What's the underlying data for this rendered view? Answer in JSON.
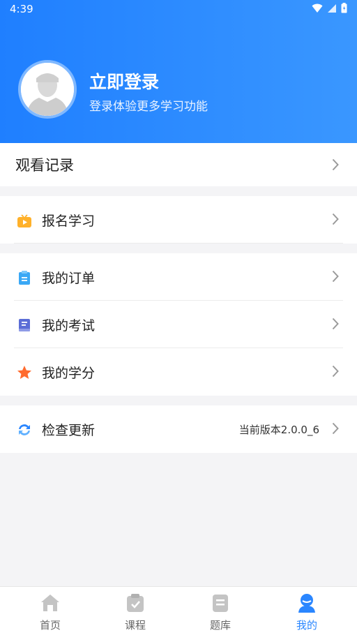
{
  "status_bar": {
    "time": "4:39"
  },
  "profile": {
    "title": "立即登录",
    "subtitle": "登录体验更多学习功能"
  },
  "watch_history": {
    "label": "观看记录"
  },
  "menu": {
    "signup": {
      "label": "报名学习",
      "icon": "tv-play-icon",
      "color": "#ffb12a"
    },
    "orders": {
      "label": "我的订单",
      "icon": "clipboard-icon",
      "color": "#3aa8f5"
    },
    "exams": {
      "label": "我的考试",
      "icon": "book-icon",
      "color": "#5b6dd6"
    },
    "credits": {
      "label": "我的学分",
      "icon": "star-icon",
      "color": "#ff6b2e"
    },
    "update": {
      "label": "检查更新",
      "icon": "refresh-icon",
      "color": "#2a86ff",
      "version": "当前版本2.0.0_6"
    }
  },
  "bottom_nav": {
    "tabs": [
      {
        "label": "首页",
        "icon": "home-icon"
      },
      {
        "label": "课程",
        "icon": "course-icon"
      },
      {
        "label": "题库",
        "icon": "question-bank-icon"
      },
      {
        "label": "我的",
        "icon": "user-icon",
        "active": true
      }
    ]
  },
  "colors": {
    "header_start": "#1f7fff",
    "header_end": "#3a97ff",
    "active_tab": "#2a86ff"
  }
}
